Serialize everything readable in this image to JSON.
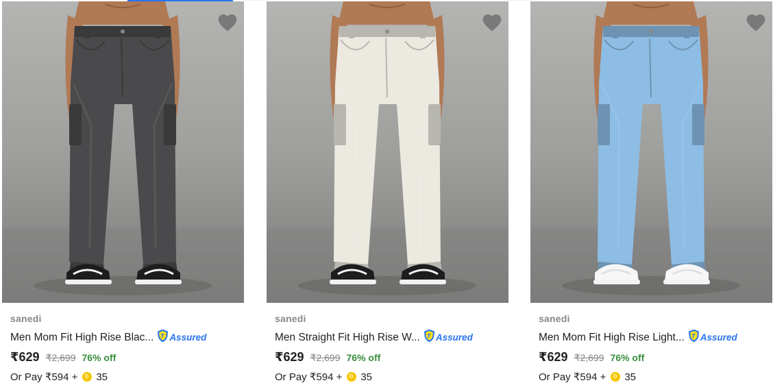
{
  "products": [
    {
      "brand": "sanedi",
      "title": "Men Mom Fit High Rise Blac...",
      "assured_label": "Assured",
      "price": "₹629",
      "mrp": "₹2,699",
      "discount": "76% off",
      "pay_prefix": "Or Pay ₹594 +",
      "coins": "35",
      "jeans_color": "#4a4a4c",
      "shoe": "black"
    },
    {
      "brand": "sanedi",
      "title": "Men Straight Fit High Rise W...",
      "assured_label": "Assured",
      "price": "₹629",
      "mrp": "₹2,699",
      "discount": "76% off",
      "pay_prefix": "Or Pay ₹594 +",
      "coins": "35",
      "jeans_color": "#ece9e1",
      "shoe": "black"
    },
    {
      "brand": "sanedi",
      "title": "Men Mom Fit High Rise Light...",
      "assured_label": "Assured",
      "price": "₹629",
      "mrp": "₹2,699",
      "discount": "76% off",
      "pay_prefix": "Or Pay ₹594 +",
      "coins": "35",
      "jeans_color": "#8dbde4",
      "shoe": "white"
    }
  ],
  "colors": {
    "accent": "#2874f0",
    "discount": "#388e3c",
    "coin": "#f7c600"
  },
  "icons": [
    "heart-icon",
    "assured-shield-icon",
    "supercoin-icon"
  ]
}
